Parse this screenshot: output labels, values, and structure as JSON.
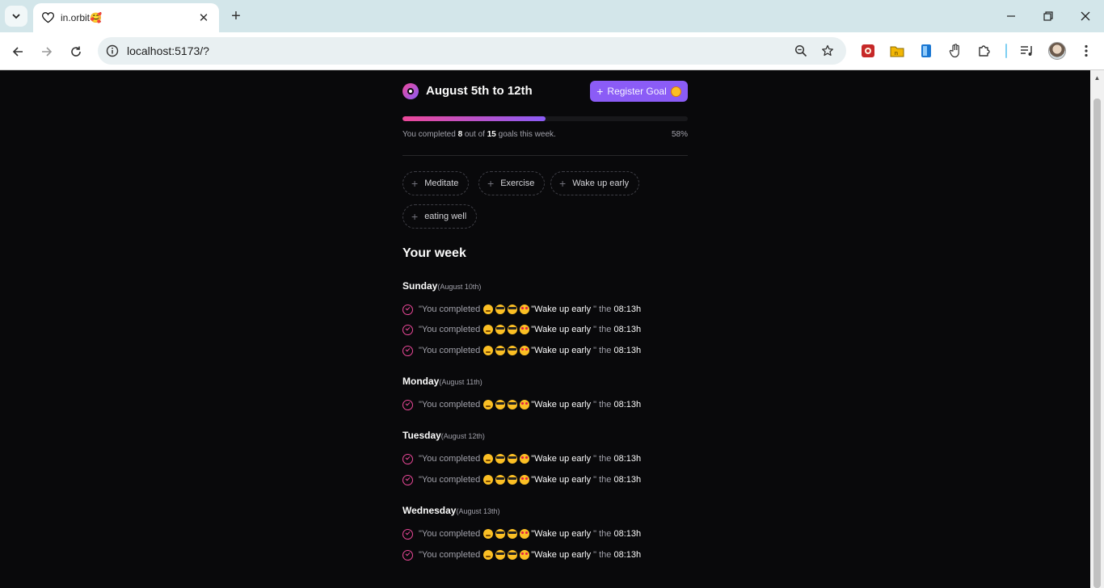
{
  "browser": {
    "tab_title": "in.orbit🥰",
    "url": "localhost:5173/?"
  },
  "app": {
    "week_title": "August 5th to 12th",
    "register_button": "Register Goal",
    "progress": {
      "prefix": "You completed",
      "completed": "8",
      "middle": "out of",
      "total": "15",
      "suffix": "goals this week.",
      "percent_label": "58%",
      "fraction": 0.5
    },
    "chips": [
      "Meditate",
      "Exercise",
      "Wake up early",
      "eating well"
    ],
    "your_week_title": "Your week",
    "entry": {
      "prefix": "\"You completed",
      "goal": "\"Wake up early",
      "mid": "\" the",
      "time": "08:13h"
    },
    "days": [
      {
        "name": "Sunday",
        "date": "(August 10th)"
      },
      {
        "name": "Monday",
        "date": "(August 11th)"
      },
      {
        "name": "Tuesday",
        "date": "(August 12th)"
      },
      {
        "name": "Wednesday",
        "date": "(August 13th)"
      }
    ]
  },
  "icons": {
    "tab_favicon": "heart-icon",
    "tab_search": "chevron-down-icon",
    "logo": "orbit-logo-icon",
    "entry_check": "circle-check-icon",
    "chip_add": "plus-icon"
  },
  "colors": {
    "background": "#09090b",
    "accent_violet": "#8b5cf6",
    "accent_pink": "#ec4899"
  }
}
